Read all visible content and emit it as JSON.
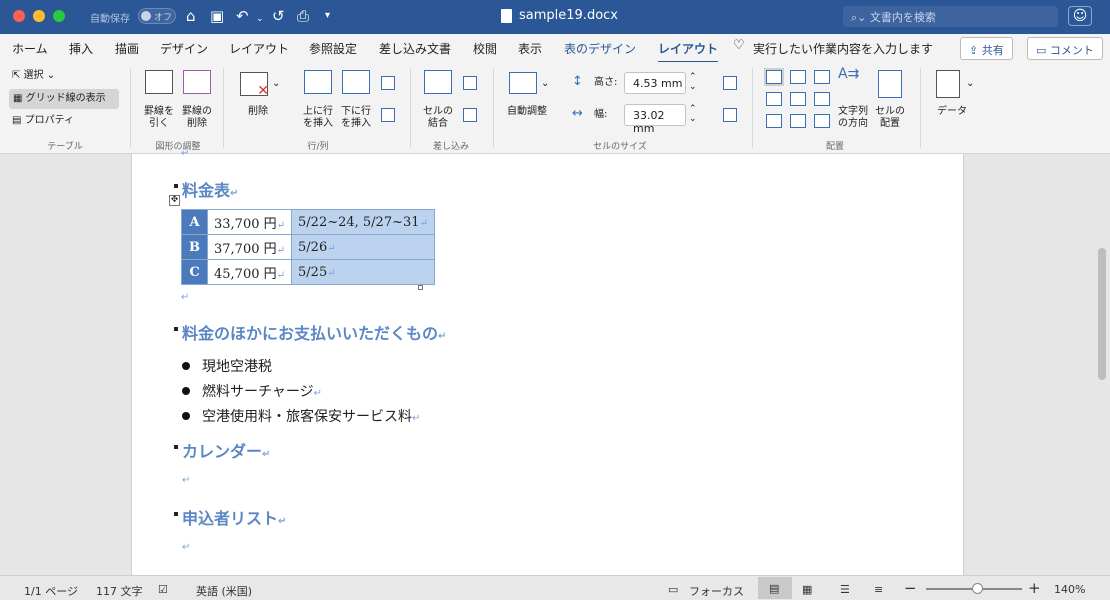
{
  "window": {
    "autosave_label": "自動保存",
    "autosave_state": "オフ",
    "doc_title": "sample19.docx",
    "search_placeholder": "文書内を検索"
  },
  "tabs": [
    "ホーム",
    "挿入",
    "描画",
    "デザイン",
    "レイアウト",
    "参照設定",
    "差し込み文書",
    "校閲",
    "表示",
    "表のデザイン",
    "レイアウト"
  ],
  "tell_me": "実行したい作業内容を入力します",
  "share_label": "共有",
  "comment_label": "コメント",
  "ribbon": {
    "table_group": {
      "select": "選択",
      "gridlines": "グリッド線の表示",
      "properties": "プロパティ",
      "label": "テーブル"
    },
    "draw_group": {
      "draw": "罫線を\n引く",
      "erase": "罫線の\n削除",
      "label": "図形の調整"
    },
    "rows_group": {
      "delete": "削除",
      "insert_above": "上に行\nを挿入",
      "insert_below": "下に行\nを挿入",
      "label": "行/列"
    },
    "merge_group": {
      "merge": "セルの\n結合",
      "label": "差し込み"
    },
    "cellsize_group": {
      "autofit": "自動調整",
      "height_label": "高さ:",
      "height_value": "4.53 mm",
      "width_label": "幅:",
      "width_value": "33.02 mm",
      "label": "セルのサイズ"
    },
    "align_group": {
      "text_direction": "文字列\nの方向",
      "cell_margins": "セルの\n配置",
      "label": "配置"
    },
    "data_group": {
      "data": "データ"
    }
  },
  "document": {
    "h1": "料金表",
    "table": [
      {
        "key": "A",
        "price": "33,700 円",
        "dates": "5/22~24, 5/27~31"
      },
      {
        "key": "B",
        "price": "37,700 円",
        "dates": "5/26"
      },
      {
        "key": "C",
        "price": "45,700 円",
        "dates": "5/25"
      }
    ],
    "h2": "料金のほかにお支払いいただくもの",
    "items": [
      "現地空港税",
      "燃料サーチャージ",
      "空港使用料・旅客保安サービス料"
    ],
    "h3": "カレンダー",
    "h4": "申込者リスト"
  },
  "status": {
    "page": "1/1 ページ",
    "words": "117 文字",
    "language": "英語 (米国)",
    "focus": "フォーカス",
    "zoom": "140%"
  },
  "colors": {
    "titlebar": "#2b5797",
    "accent": "#2b579a",
    "heading": "#5b87c5",
    "table_header": "#4b7bbd",
    "table_selected": "#bcd3f0"
  }
}
